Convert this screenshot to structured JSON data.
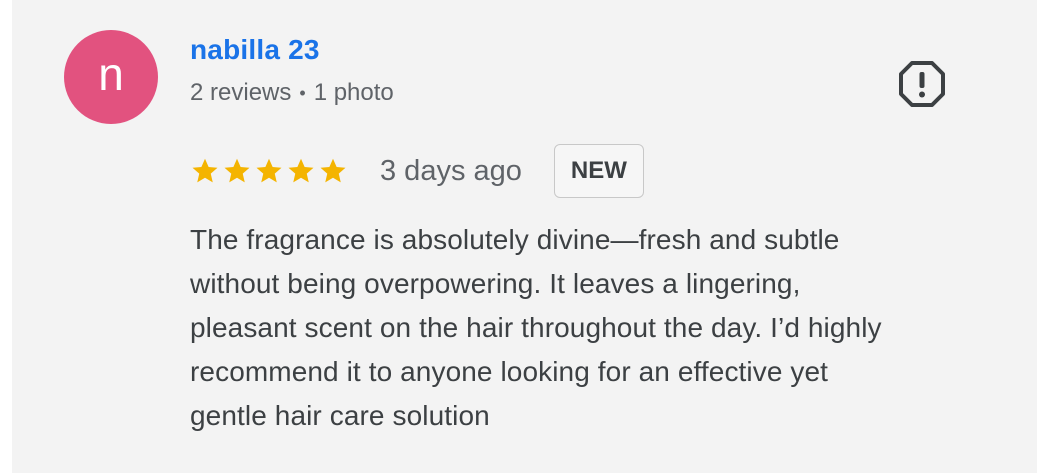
{
  "review": {
    "avatar_letter": "n",
    "author_name": "nabilla 23",
    "reviews_count": "2 reviews",
    "separator": "•",
    "photos_count": "1 photo",
    "rating": 5,
    "rating_max": 5,
    "date": "3 days ago",
    "badge": "NEW",
    "text_lines": [
      "The fragrance is absolutely divine—fresh and subtle",
      "without being overpowering. It leaves a lingering,",
      "pleasant scent on the hair throughout the day. I’d highly",
      "recommend it to anyone looking for an effective yet",
      "gentle hair care solution"
    ]
  },
  "icons": {
    "report": "report-flag-icon",
    "star": "star-icon"
  },
  "colors": {
    "avatar_bg": "#e2527f",
    "author_link": "#1a73e8",
    "star": "#f4b400",
    "card_bg": "#f3f3f3",
    "text": "#3c4043",
    "secondary_text": "#5f6368"
  }
}
